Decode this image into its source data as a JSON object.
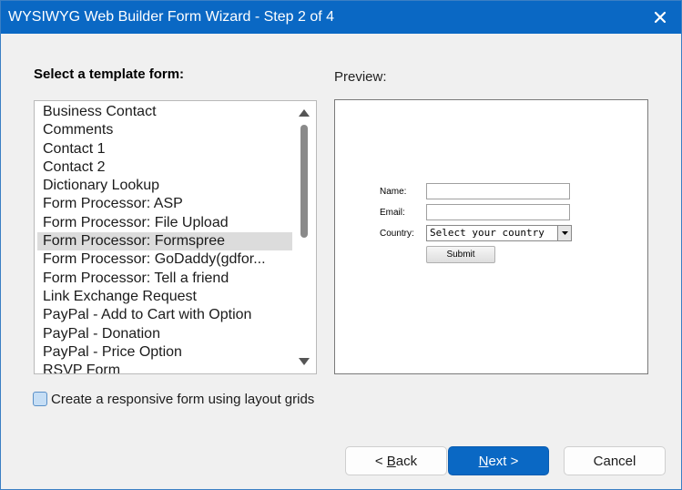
{
  "window": {
    "title": "WYSIWYG Web Builder Form Wizard - Step 2 of 4"
  },
  "labels": {
    "select_template": "Select a template form:",
    "preview": "Preview:"
  },
  "template_list": {
    "items": [
      {
        "label": "Business Contact"
      },
      {
        "label": "Comments"
      },
      {
        "label": "Contact 1"
      },
      {
        "label": "Contact 2"
      },
      {
        "label": "Dictionary Lookup"
      },
      {
        "label": "Form Processor: ASP"
      },
      {
        "label": "Form Processor: File Upload"
      },
      {
        "label": "Form Processor: Formspree",
        "selected": true
      },
      {
        "label": "Form Processor: GoDaddy(gdfor..."
      },
      {
        "label": "Form Processor: Tell a friend"
      },
      {
        "label": "Link Exchange Request"
      },
      {
        "label": "PayPal - Add to Cart with Option"
      },
      {
        "label": "PayPal - Donation"
      },
      {
        "label": "PayPal - Price Option"
      },
      {
        "label": "RSVP Form"
      }
    ]
  },
  "preview_form": {
    "name_label": "Name:",
    "email_label": "Email:",
    "country_label": "Country:",
    "country_value": "Select your country",
    "submit_label": "Submit"
  },
  "options": {
    "responsive_checkbox_label": "Create a responsive form using layout grids",
    "responsive_checked": false
  },
  "buttons": {
    "back_prefix": "< ",
    "back_mnemonic": "B",
    "back_rest": "ack",
    "next_mnemonic": "N",
    "next_rest": "ext >",
    "cancel": "Cancel"
  },
  "colors": {
    "titlebar": "#0a68c4",
    "primary_button": "#0a68c4",
    "selected_row": "#dcdcdc"
  }
}
